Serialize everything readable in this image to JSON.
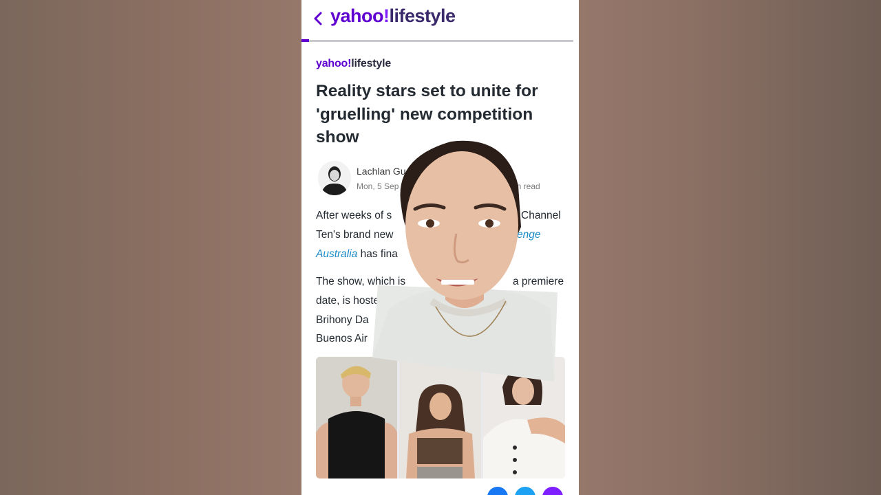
{
  "header": {
    "brand_yahoo": "yahoo",
    "brand_bang": "!",
    "brand_lifestyle": "lifestyle"
  },
  "article": {
    "brand_yahoo": "yahoo",
    "brand_bang": "!",
    "brand_lifestyle": "lifestyle",
    "headline": "Reality stars set to unite for 'gruelling' new competition show",
    "author": "Lachlan Gu",
    "date": "Mon, 5 Sep",
    "read_time": "min read",
    "p1_line1_a": "After weeks of s",
    "p1_line1_b": "Channel",
    "p1_line2_a": "Ten's brand new",
    "p1_line2_link": "enge",
    "p1_line3_link": "Australia",
    "p1_line3_b": " has fina",
    "p2_line1_a": "The show, which is",
    "p2_line1_b": "a premiere",
    "p2_line2_a": "date, is hosted by A",
    "p2_line3_a": "Brihony Da",
    "p2_line4_a": "Buenos Air"
  },
  "colors": {
    "brand_purple": "#5f01d1",
    "link_blue": "#1a8bc6",
    "headline_text": "#232a31"
  },
  "icons": [
    "back-chevron-icon",
    "facebook-share-icon",
    "twitter-share-icon",
    "email-share-icon"
  ],
  "reading_progress_percent": 3
}
